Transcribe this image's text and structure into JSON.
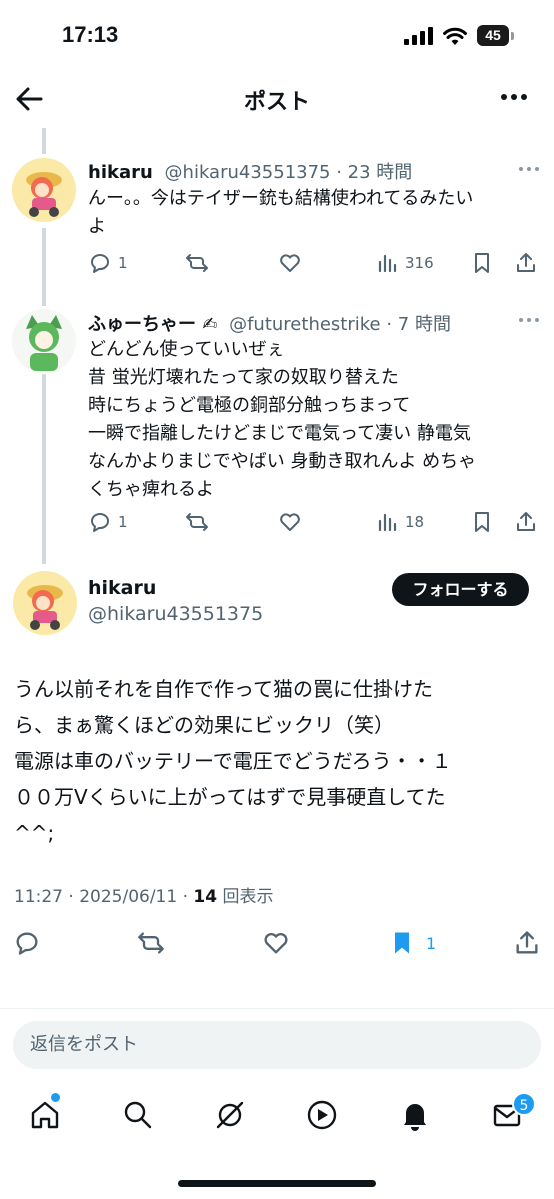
{
  "status": {
    "time": "17:13",
    "battery": "45"
  },
  "header": {
    "title": "ポスト"
  },
  "replies": [
    {
      "name": "hikaru",
      "meta": "@hikaru43551375 · 23 時間",
      "text": "んー。。今はテイザー銃も結構使われてるみたいよ",
      "text_lines": [
        "んー。。今はテイザー銃も結構使われてるみたい",
        "よ"
      ],
      "reply_count": "1",
      "views": "316"
    },
    {
      "name": "ふゅーちゃー ✍",
      "meta": "@futurethestrike · 7 時間",
      "text_lines": [
        "どんどん使っていいぜぇ",
        "昔 蛍光灯壊れたって家の奴取り替えた",
        "時にちょうど電極の銅部分触っちまって",
        "一瞬で指離したけどまじで電気って凄い 静電気",
        "なんかよりまじでやばい 身動き取れんよ めちゃ",
        "くちゃ痺れるよ"
      ],
      "reply_count": "1",
      "views": "18"
    }
  ],
  "main_post": {
    "name": "hikaru",
    "handle": "@hikaru43551375",
    "follow_label": "フォローする",
    "text_lines": [
      "うん以前それを自作で作って猫の罠に仕掛けた",
      "ら、まぁ驚くほどの効果にビックリ（笑）",
      "電源は車のバッテリーで電圧でどうだろう・・１",
      "００万Vくらいに上がってはずで見事硬直してた",
      "^^;"
    ],
    "timestamp": "11:27 · 2025/06/11 · ",
    "views_count": "14",
    "views_label": " 回表示",
    "bookmark_count": "1"
  },
  "reply_box": {
    "placeholder": "返信をポスト"
  },
  "tabbar": {
    "items": [
      "home-icon",
      "search-icon",
      "grok-icon",
      "video-icon",
      "notifications-icon",
      "messages-icon"
    ],
    "messages_badge": "5"
  },
  "colors": {
    "accent": "#1d9bf0",
    "text": "#0f1419",
    "muted": "#536471"
  }
}
